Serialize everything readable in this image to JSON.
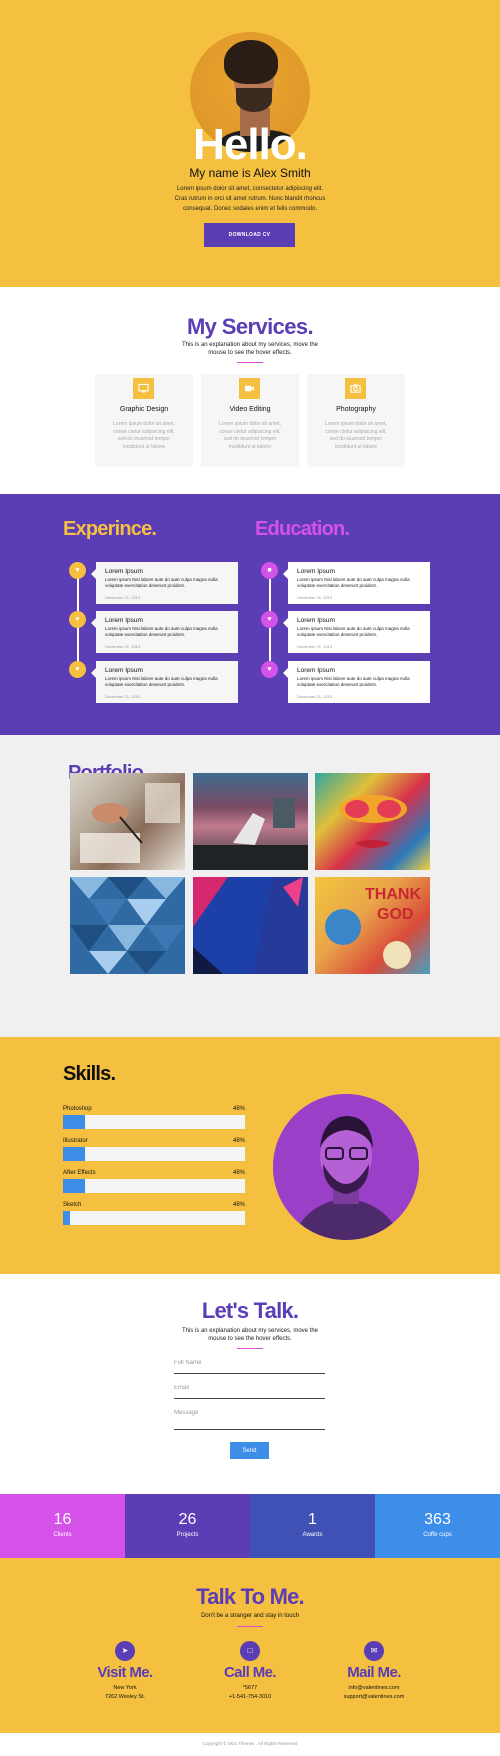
{
  "hero": {
    "title": "Hello.",
    "subtitle": "My name is Alex Smith",
    "text": "Lorem ipsum dolor sit amet, consectetur adipiscing elit. Cras rutrum in orci sit amet rutrum. Nunc blandit rhoncus consequat. Donec sodales enim et felis commodo.",
    "button": "DOWNLOAD CV"
  },
  "services": {
    "title": "My Services.",
    "subtitle": "This is an explanation about my services, move the mouse to see the hover effects.",
    "items": [
      {
        "label": "Graphic Design",
        "icon": "monitor-icon",
        "text": "Lorem ipsum dolor sit amet, conse ctetur adipisicing elit, sed do eiusmod tempor incididunt ut labore"
      },
      {
        "label": "Video Editing",
        "icon": "video-camera-icon",
        "text": "Lorem ipsum dolor sit amet, conse ctetur adipisicing elit, sed do eiusmod tempor incididunt ut labore"
      },
      {
        "label": "Photography",
        "icon": "camera-icon",
        "text": "Lorem ipsum dolor sit amet, conse ctetur adipisicing elit, sed do eiusmod tempor incididunt ut labore"
      }
    ]
  },
  "experience": {
    "title": "Experince.",
    "items": [
      {
        "title": "Lorem Ipsum",
        "text": "Lorem ipsum Nisi labore aute do aute culpa magna nulla voluptate exercitation deserunt proident.",
        "date": "December 21, 2019"
      },
      {
        "title": "Lorem Ipsum",
        "text": "Lorem ipsum Nisi labore aute do aute culpa magna nulla voluptate exercitation deserunt proident.",
        "date": "December 21, 2019"
      },
      {
        "title": "Lorem Ipsum",
        "text": "Lorem ipsum Nisi labore aute do aute culpa magna nulla voluptate exercitation deserunt proident.",
        "date": "December 21, 2019"
      }
    ]
  },
  "education": {
    "title": "Education.",
    "items": [
      {
        "title": "Lorem Ipsum",
        "text": "Lorem ipsum Nisi labore aute do aute culpa magna nulla voluptate exercitation deserunt proident.",
        "date": "December 21, 2019"
      },
      {
        "title": "Lorem Ipsum",
        "text": "Lorem ipsum Nisi labore aute do aute culpa magna nulla voluptate exercitation deserunt proident.",
        "date": "December 21, 2019"
      },
      {
        "title": "Lorem Ipsum",
        "text": "Lorem ipsum Nisi labore aute do aute culpa magna nulla voluptate exercitation deserunt proident.",
        "date": "December 21, 2019"
      }
    ]
  },
  "portfolio": {
    "title": "Portfolio."
  },
  "skills": {
    "title": "Skills.",
    "items": [
      {
        "name": "Photoshop",
        "pct_label": "48%",
        "fill": 0.12
      },
      {
        "name": "Illustrator",
        "pct_label": "48%",
        "fill": 0.12
      },
      {
        "name": "After Effects",
        "pct_label": "48%",
        "fill": 0.12
      },
      {
        "name": "Sketch",
        "pct_label": "48%",
        "fill": 0.04
      }
    ]
  },
  "contact": {
    "title": "Let's Talk.",
    "subtitle": "This is an explanation about my services, move the mouse to see the hover effects.",
    "name_placeholder": "Full Name",
    "email_placeholder": "Email",
    "message_placeholder": "Message",
    "send": "Send"
  },
  "stats": [
    {
      "number": "16",
      "label": "Clients",
      "color": "#d452e8"
    },
    {
      "number": "26",
      "label": "Projects",
      "color": "#5b3db5"
    },
    {
      "number": "1",
      "label": "Awards",
      "color": "#3f51b5"
    },
    {
      "number": "363",
      "label": "Coffe cups",
      "color": "#3d8ee8"
    }
  ],
  "talk": {
    "title": "Talk To Me.",
    "subtitle": "Don't be a stranger and stay in touch",
    "items": [
      {
        "heading": "Visit Me.",
        "icon": "location-arrow-icon",
        "line1": "New York",
        "line2": "7262 Wesley St."
      },
      {
        "heading": "Call Me.",
        "icon": "phone-icon",
        "line1": "*5677",
        "line2": "+1-541-754-3010"
      },
      {
        "heading": "Mail Me.",
        "icon": "envelope-icon",
        "line1": "info@valentines.com",
        "line2": "support@valentines.com"
      }
    ]
  },
  "footer": {
    "text": "Copyright © Skra Themes . All Rights Reserved"
  },
  "colors": {
    "yellow": "#f5c040",
    "purple": "#5b3db5",
    "magenta": "#d452e8",
    "blue": "#3d8ee8"
  }
}
